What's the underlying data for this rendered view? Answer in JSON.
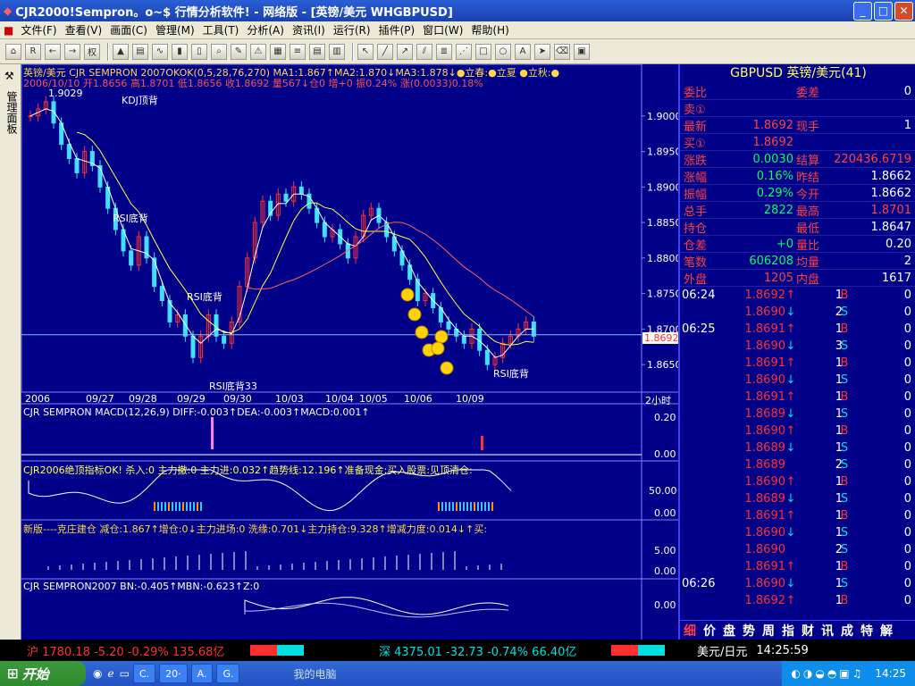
{
  "window": {
    "title": "CJR2000!Sempron。o~$          行情分析软件! - 网络版 - [英镑/美元 WHGBPUSD]",
    "buttons": [
      "_",
      "□",
      "✕"
    ]
  },
  "menu": [
    "文件(F)",
    "查看(V)",
    "画面(C)",
    "管理(M)",
    "工具(T)",
    "分析(A)",
    "资讯(I)",
    "运行(R)",
    "插件(P)",
    "窗口(W)",
    "帮助(H)"
  ],
  "sidebar": {
    "label": "管理面板"
  },
  "chart_header": {
    "line1": "英镑/美元 CJR SEMPRON 2007OKOK(0,5,28,76,270) MA1:1.867↑MA2:1.870↓MA3:1.878↓●立春:●立夏 ●立秋:●",
    "line2": "2006/10/10 开1.8656 高1.8701 低1.8656 收1.8692 量567↓仓0 增+0 振0.24% 涨(0.0033)0.18%"
  },
  "chart_labels": {
    "max_label": "1.9029",
    "kdj": "KDJ顶背",
    "rsi1": "RSI底背",
    "rsi2": "RSI底背",
    "rsi3": "RSI底背33",
    "rsi4": "RSI底背",
    "cur_price": "1.8692",
    "period": "2小时"
  },
  "chart_data": {
    "type": "candlestick",
    "instrument": "GBPUSD",
    "y_ticks": [
      "1.9000",
      "1.8950",
      "1.8900",
      "1.8850",
      "1.8800",
      "1.8750",
      "1.8700",
      "1.8650"
    ],
    "ylim": [
      1.862,
      1.904
    ],
    "x_labels": [
      "2006",
      "09/27",
      "09/28",
      "09/29",
      "09/30",
      "10/03",
      "10/04",
      "10/05",
      "10/06",
      "10/09"
    ],
    "closes": [
      1.9,
      1.901,
      1.902,
      1.899,
      1.896,
      1.894,
      1.892,
      1.895,
      1.893,
      1.89,
      1.887,
      1.884,
      1.881,
      1.879,
      1.883,
      1.88,
      1.876,
      1.874,
      1.871,
      1.872,
      1.869,
      1.866,
      1.869,
      1.872,
      1.869,
      1.868,
      1.871,
      1.876,
      1.88,
      1.885,
      1.888,
      1.886,
      1.889,
      1.888,
      1.89,
      1.889,
      1.887,
      1.885,
      1.883,
      1.884,
      1.882,
      1.88,
      1.883,
      1.886,
      1.887,
      1.885,
      1.883,
      1.881,
      1.879,
      1.877,
      1.874,
      1.875,
      1.873,
      1.871,
      1.87,
      1.869,
      1.868,
      1.87,
      1.867,
      1.865,
      1.866,
      1.868,
      1.869,
      1.87,
      1.871,
      1.869
    ]
  },
  "indicators": {
    "macd": {
      "header": "CJR SEMPRON MACD(12,26,9) DIFF:-0.003↑DEA:-0.003↑MACD:0.001↑",
      "ticks": [
        "0.20",
        "0.00"
      ]
    },
    "ind2": {
      "header": "CJR2006绝顶指标OK! 杀入:0 主力撤:0 主力进:0.032↑趋势线:12.196↑准备现金:买入股票:见顶清仓:",
      "ticks": [
        "50.00",
        "0.00"
      ]
    },
    "ind3": {
      "header": "新版----克庄建仓 减仓:1.867↑增仓:0↓主力进场:0 洗缘:0.701↓主力持仓:9.328↑增减力度:0.014↓↑买:",
      "ticks": [
        "5.00",
        "0.00"
      ]
    },
    "ind4": {
      "header": "CJR SEMPRON2007 BN:-0.405↑MBN:-0.623↑Z:0",
      "ticks": [
        "0.00"
      ]
    }
  },
  "quote": {
    "title": "GBPUSD 英镑/美元(41)",
    "rows": [
      {
        "l": "委比",
        "v": "",
        "l2": "委差",
        "v2": "0"
      },
      {
        "l": "卖①",
        "v": "",
        "l2": "",
        "v2": ""
      },
      {
        "l": "最新",
        "v": "1.8692",
        "l2": "现手",
        "v2": "1"
      },
      {
        "l": "买①",
        "v": "1.8692",
        "l2": "",
        "v2": ""
      },
      {
        "l": "涨跌",
        "v": "0.0030",
        "l2": "结算",
        "v2": "220436.6719"
      },
      {
        "l": "涨幅",
        "v": "0.16%",
        "l2": "昨结",
        "v2": "1.8662"
      },
      {
        "l": "振幅",
        "v": "0.29%",
        "l2": "今开",
        "v2": "1.8662"
      },
      {
        "l": "总手",
        "v": "2822",
        "l2": "最高",
        "v2": "1.8701"
      },
      {
        "l": "持仓",
        "v": "",
        "l2": "最低",
        "v2": "1.8647"
      },
      {
        "l": "仓差",
        "v": "+0",
        "l2": "量比",
        "v2": "0.20"
      },
      {
        "l": "笔数",
        "v": "606208",
        "l2": "均量",
        "v2": "2"
      },
      {
        "l": "外盘",
        "v": "1205",
        "l2": "内盘",
        "v2": "1617"
      }
    ],
    "ticks": [
      {
        "t": "06:24",
        "p": "1.8692",
        "d": "up",
        "v": "1",
        "bs": "B",
        "c": "0"
      },
      {
        "t": "",
        "p": "1.8690",
        "d": "down",
        "v": "2",
        "bs": "S",
        "c": "0"
      },
      {
        "t": "06:25",
        "p": "1.8691",
        "d": "up",
        "v": "1",
        "bs": "B",
        "c": "0"
      },
      {
        "t": "",
        "p": "1.8690",
        "d": "down",
        "v": "3",
        "bs": "S",
        "c": "0"
      },
      {
        "t": "",
        "p": "1.8691",
        "d": "up",
        "v": "1",
        "bs": "B",
        "c": "0"
      },
      {
        "t": "",
        "p": "1.8690",
        "d": "down",
        "v": "1",
        "bs": "S",
        "c": "0"
      },
      {
        "t": "",
        "p": "1.8691",
        "d": "up",
        "v": "1",
        "bs": "B",
        "c": "0"
      },
      {
        "t": "",
        "p": "1.8689",
        "d": "down",
        "v": "1",
        "bs": "S",
        "c": "0"
      },
      {
        "t": "",
        "p": "1.8690",
        "d": "up",
        "v": "1",
        "bs": "B",
        "c": "0"
      },
      {
        "t": "",
        "p": "1.8689",
        "d": "down",
        "v": "1",
        "bs": "S",
        "c": "0"
      },
      {
        "t": "",
        "p": "1.8689",
        "d": "",
        "v": "2",
        "bs": "S",
        "c": "0"
      },
      {
        "t": "",
        "p": "1.8690",
        "d": "up",
        "v": "1",
        "bs": "B",
        "c": "0"
      },
      {
        "t": "",
        "p": "1.8689",
        "d": "down",
        "v": "1",
        "bs": "S",
        "c": "0"
      },
      {
        "t": "",
        "p": "1.8691",
        "d": "up",
        "v": "1",
        "bs": "B",
        "c": "0"
      },
      {
        "t": "",
        "p": "1.8690",
        "d": "down",
        "v": "1",
        "bs": "S",
        "c": "0"
      },
      {
        "t": "",
        "p": "1.8690",
        "d": "",
        "v": "2",
        "bs": "S",
        "c": "0"
      },
      {
        "t": "",
        "p": "1.8691",
        "d": "up",
        "v": "1",
        "bs": "B",
        "c": "0"
      },
      {
        "t": "06:26",
        "p": "1.8690",
        "d": "down",
        "v": "1",
        "bs": "S",
        "c": "0"
      },
      {
        "t": "",
        "p": "1.8692",
        "d": "up",
        "v": "1",
        "bs": "B",
        "c": "0"
      }
    ],
    "tabs": [
      "细",
      "价",
      "盘",
      "势",
      "周",
      "指",
      "财",
      "讯",
      "成",
      "特",
      "解"
    ]
  },
  "status": {
    "sh": "沪 1780.18 -5.20 -0.29% 135.68亿",
    "sz": "深 4375.01 -32.73 -0.74% 66.40亿",
    "pair": "美元/日元",
    "time": "14:25:59"
  },
  "taskbar": {
    "start": "开始",
    "tasks": [
      "C.",
      "20·",
      "A.",
      "G."
    ],
    "computer": "我的电脑",
    "clock": "14:25"
  },
  "colors": {
    "up": "#ff3030",
    "down": "#00e0e0",
    "bg": "#000088"
  }
}
